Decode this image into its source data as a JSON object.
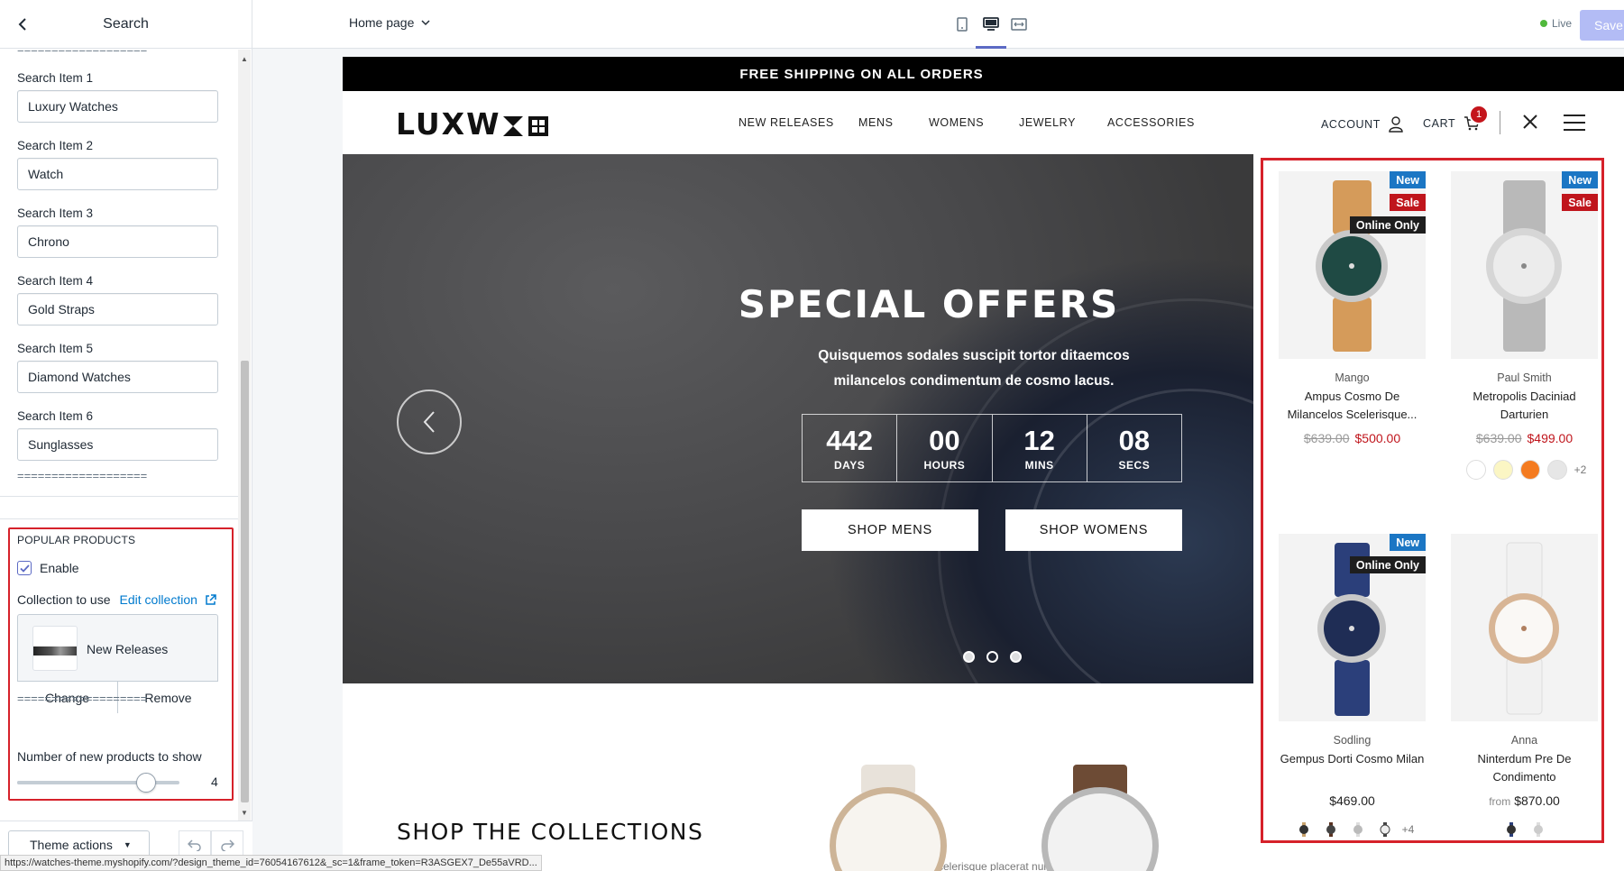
{
  "sidebar": {
    "title": "Search",
    "separator": "===================",
    "items": [
      {
        "label": "Search Item 1",
        "value": "Luxury Watches"
      },
      {
        "label": "Search Item 2",
        "value": "Watch"
      },
      {
        "label": "Search Item 3",
        "value": "Chrono"
      },
      {
        "label": "Search Item 4",
        "value": "Gold Straps"
      },
      {
        "label": "Search Item 5",
        "value": "Diamond Watches"
      },
      {
        "label": "Search Item 6",
        "value": "Sunglasses"
      }
    ],
    "popular": {
      "title": "POPULAR PRODUCTS",
      "enable_label": "Enable",
      "enabled": true,
      "collection_label": "Collection to use",
      "edit_link": "Edit collection",
      "collection_name": "New Releases",
      "change_label": "Change",
      "remove_label": "Remove",
      "count_label": "Number of new products to show",
      "count_value": "4",
      "count_fraction": 0.75
    },
    "footer": {
      "theme_actions": "Theme actions"
    }
  },
  "topbar": {
    "page_select": "Home page",
    "live_label": "Live",
    "save_label": "Save"
  },
  "store": {
    "announcement": "FREE SHIPPING ON ALL ORDERS",
    "logo_text": "LUXW",
    "nav": [
      "NEW RELEASES",
      "MENS",
      "WOMENS",
      "JEWELRY",
      "ACCESSORIES"
    ],
    "account_label": "ACCOUNT",
    "cart_label": "CART",
    "cart_count": "1",
    "hero": {
      "title": "SPECIAL OFFERS",
      "subtitle": "Quisquemos sodales suscipit tortor ditaemcos milancelos condimentum de cosmo lacus.",
      "countdown": [
        {
          "num": "442",
          "label": "DAYS"
        },
        {
          "num": "00",
          "label": "HOURS"
        },
        {
          "num": "12",
          "label": "MINS"
        },
        {
          "num": "08",
          "label": "SECS"
        }
      ],
      "btn_mens": "SHOP MENS",
      "btn_womens": "SHOP WOMENS",
      "active_slide": 2,
      "slide_count": 3
    },
    "collections_title": "SHOP THE COLLECTIONS",
    "collections_sub": "celerisque placerat nulla deumantes"
  },
  "products": [
    {
      "vendor": "Mango",
      "name": "Ampus Cosmo De Milancelos Scelerisque...",
      "old_price": "$639.00",
      "price": "$500.00",
      "tags": [
        "New",
        "Sale",
        "Online Only"
      ],
      "swatches": [],
      "more": ""
    },
    {
      "vendor": "Paul Smith",
      "name": "Metropolis Daciniad Darturien",
      "old_price": "$639.00",
      "price": "$499.00",
      "tags": [
        "New",
        "Sale"
      ],
      "swatches": [
        "#ffffff",
        "#fbf6c4",
        "#f47b20",
        "#e6e6e6"
      ],
      "more": "+2"
    },
    {
      "vendor": "Sodling",
      "name": "Gempus Dorti Cosmo Milan",
      "old_price": "",
      "price": "$469.00",
      "tags": [
        "New",
        "Online Only"
      ],
      "swatches": [],
      "more": "+4"
    },
    {
      "vendor": "Anna",
      "name": "Ninterdum Pre De Condimento",
      "old_price": "",
      "from": "from",
      "price": "$870.00",
      "tags": [],
      "swatches": [],
      "more": ""
    }
  ],
  "status_url": "https://watches-theme.myshopify.com/?design_theme_id=76054167612&_sc=1&frame_token=R3ASGEX7_De55aVRD..."
}
